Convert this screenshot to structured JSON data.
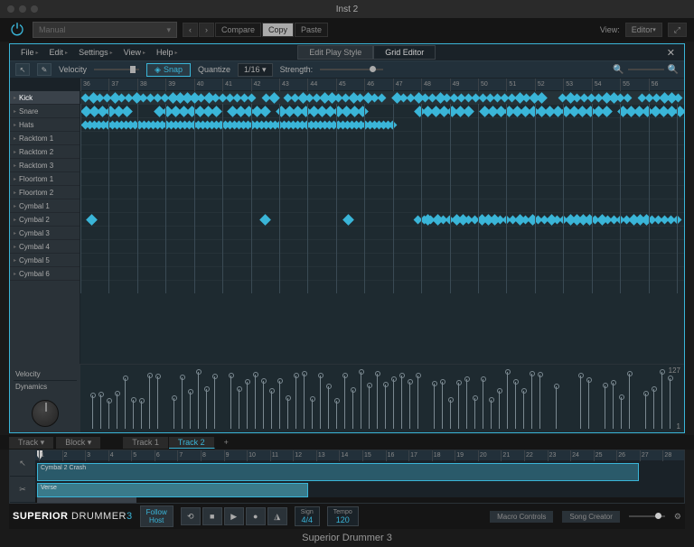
{
  "window": {
    "title": "Inst 2"
  },
  "host_toolbar": {
    "preset": "Manual",
    "compare": "Compare",
    "copy": "Copy",
    "paste": "Paste",
    "view_label": "View:",
    "view_value": "Editor"
  },
  "menubar": {
    "items": [
      "File",
      "Edit",
      "Settings",
      "View",
      "Help"
    ],
    "tabs": [
      {
        "label": "Edit Play Style",
        "active": false
      },
      {
        "label": "Grid Editor",
        "active": true
      }
    ]
  },
  "editbar": {
    "velocity_label": "Velocity",
    "snap": "Snap",
    "quantize_label": "Quantize",
    "quantize_value": "1/16",
    "strength_label": "Strength:"
  },
  "ruler_ticks": [
    36,
    37,
    38,
    39,
    40,
    41,
    42,
    43,
    44,
    45,
    46,
    47,
    48,
    49,
    50,
    51,
    52,
    53,
    54,
    55,
    56
  ],
  "lanes": [
    {
      "name": "Kick",
      "sel": true
    },
    {
      "name": "Snare",
      "sel": false
    },
    {
      "name": "Hats",
      "sel": false
    },
    {
      "name": "Racktom 1",
      "sel": false
    },
    {
      "name": "Racktom 2",
      "sel": false
    },
    {
      "name": "Racktom 3",
      "sel": false
    },
    {
      "name": "Floortom 1",
      "sel": false
    },
    {
      "name": "Floortom 2",
      "sel": false
    },
    {
      "name": "Cymbal 1",
      "sel": false
    },
    {
      "name": "Cymbal 2",
      "sel": false
    },
    {
      "name": "Cymbal 3",
      "sel": false
    },
    {
      "name": "Cymbal 4",
      "sel": false
    },
    {
      "name": "Cymbal 5",
      "sel": false
    },
    {
      "name": "Cymbal 6",
      "sel": false
    }
  ],
  "velocity_panel": {
    "label": "Velocity",
    "dyn_label": "Dynamics",
    "max": "127",
    "min": "1"
  },
  "track_tabs": {
    "left": [
      "Track",
      "Block"
    ],
    "tracks": [
      {
        "label": "Track 1",
        "active": false
      },
      {
        "label": "Track 2",
        "active": true
      }
    ]
  },
  "timeline": {
    "ticks": [
      1,
      2,
      3,
      4,
      5,
      6,
      7,
      8,
      9,
      10,
      11,
      12,
      13,
      14,
      15,
      16,
      17,
      18,
      19,
      20,
      21,
      22,
      23,
      24,
      25,
      26,
      27,
      28
    ],
    "clip1": "Cymbal 2 Crash",
    "clip2": "Verse"
  },
  "transport": {
    "product": {
      "a": "SUPERIOR",
      "b": "DRUMMER",
      "n": "3"
    },
    "follow": "Follow\nHost",
    "sign_label": "Sign",
    "sign_value": "4/4",
    "tempo_label": "Tempo",
    "tempo_value": "120",
    "macro": "Macro Controls",
    "song": "Song Creator"
  },
  "caption": "Superior Drummer 3"
}
